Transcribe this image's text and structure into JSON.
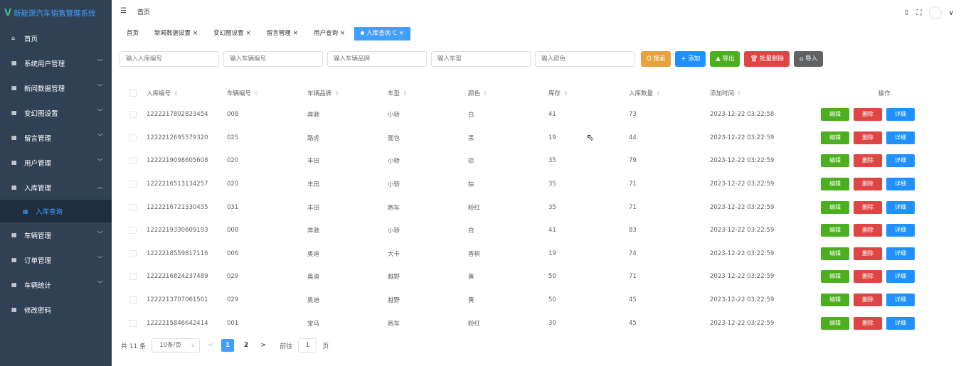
{
  "app": {
    "title": "新能源汽车销售管理系统",
    "logo": "V"
  },
  "navbar": {
    "breadcrumb": "首页",
    "hamburger": "☰",
    "icons": [
      "⇧",
      "⛶",
      "∨"
    ]
  },
  "sidebar": {
    "items": [
      {
        "icon": "⌂",
        "label": "首页",
        "chev": ""
      },
      {
        "icon": "▦",
        "label": "系统用户管理",
        "chev": "﹀"
      },
      {
        "icon": "▦",
        "label": "新闻数据管理",
        "chev": "﹀"
      },
      {
        "icon": "▦",
        "label": "变幻图设置",
        "chev": "﹀"
      },
      {
        "icon": "▦",
        "label": "留言管理",
        "chev": "﹀"
      },
      {
        "icon": "▦",
        "label": "用户管理",
        "chev": "﹀"
      },
      {
        "icon": "▦",
        "label": "入库管理",
        "chev": "︿"
      },
      {
        "icon": "▦",
        "label": "车辆管理",
        "chev": "﹀"
      },
      {
        "icon": "▦",
        "label": "订单管理",
        "chev": "﹀"
      },
      {
        "icon": "▦",
        "label": "车辆统计",
        "chev": "﹀"
      },
      {
        "icon": "▦",
        "label": "修改密码",
        "chev": ""
      }
    ],
    "sub_item": {
      "icon": "▦",
      "label": "入库查询"
    }
  },
  "tags": [
    {
      "label": "首页",
      "close": ""
    },
    {
      "label": "新闻数据设置",
      "close": "×"
    },
    {
      "label": "变幻图设置",
      "close": "×"
    },
    {
      "label": "留言管理",
      "close": "×"
    },
    {
      "label": "用户查询",
      "close": "×"
    },
    {
      "label": "入库查询",
      "close": "C ×",
      "active": true
    }
  ],
  "search": {
    "placeholders": [
      "输入入库编号",
      "输入车辆编号",
      "输入车辆品牌",
      "输入车型",
      "输入颜色"
    ],
    "buttons": {
      "search": "Q 搜索",
      "add": "+ 添加",
      "export": "▲ 导出",
      "batch_delete": "🗑 批量删除",
      "import": "⌂ 导入"
    }
  },
  "table": {
    "sort_icon": "⇕",
    "headers": [
      "入库编号",
      "车辆编号",
      "车辆品牌",
      "车型",
      "颜色",
      "库存",
      "入库数量",
      "添加时间"
    ],
    "ops_header": "操作",
    "op_labels": {
      "edit": "编辑",
      "delete": "删除",
      "detail": "详细"
    },
    "rows": [
      [
        "1222217802823454",
        "008",
        "奔驰",
        "小轿",
        "白",
        "41",
        "73",
        "2023-12-22 03:22:58"
      ],
      [
        "1222212695579320",
        "025",
        "路虎",
        "面包",
        "黑",
        "19",
        "44",
        "2023-12-22 03:22:59"
      ],
      [
        "1222219098605608",
        "020",
        "丰田",
        "小轿",
        "棕",
        "35",
        "79",
        "2023-12-22 03:22:59"
      ],
      [
        "1222216513134257",
        "020",
        "丰田",
        "小轿",
        "棕",
        "35",
        "71",
        "2023-12-22 03:22:59"
      ],
      [
        "1222216721330435",
        "031",
        "丰田",
        "跑车",
        "粉红",
        "35",
        "71",
        "2023-12-22 03:22:59"
      ],
      [
        "1222219330609193",
        "008",
        "奔驰",
        "小轿",
        "白",
        "41",
        "83",
        "2023-12-22 03:22:59"
      ],
      [
        "1222218559817116",
        "006",
        "奥迪",
        "大卡",
        "香槟",
        "19",
        "74",
        "2023-12-22 03:22:59"
      ],
      [
        "1222216824237489",
        "029",
        "奥迪",
        "越野",
        "黄",
        "50",
        "71",
        "2023-12-22 03:22:59"
      ],
      [
        "1222213707061501",
        "029",
        "奥迪",
        "越野",
        "黄",
        "50",
        "45",
        "2023-12-22 03:22:59"
      ],
      [
        "1222215846642414",
        "001",
        "宝马",
        "跑车",
        "粉红",
        "30",
        "45",
        "2023-12-22 03:22:59"
      ]
    ]
  },
  "pagination": {
    "total": "共 11 条",
    "page_size": "10条/页",
    "size_chev": "∨",
    "prev": "<",
    "next": ">",
    "pages": [
      "1",
      "2"
    ],
    "goto_prefix": "前往",
    "goto_value": "1",
    "goto_suffix": "页"
  },
  "colors": {
    "sidebar_bg": "#304156",
    "accent": "#409eff",
    "edit": "#4caf1f",
    "delete": "#e04545",
    "detail": "#1e90ff"
  }
}
